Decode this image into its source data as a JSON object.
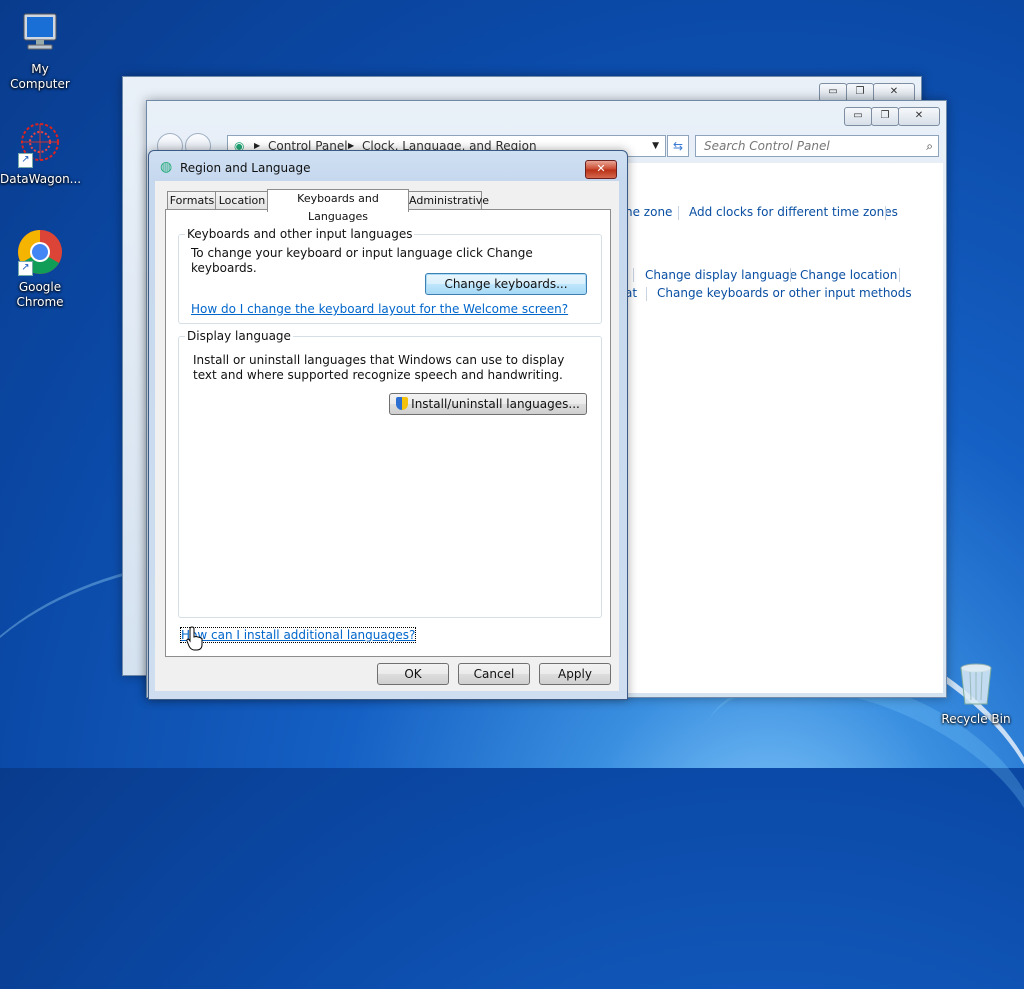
{
  "desktop": {
    "icons": [
      {
        "label": "My Computer"
      },
      {
        "label": "DataWagon..."
      },
      {
        "label": "Google Chrome"
      },
      {
        "label": "Recycle Bin"
      }
    ]
  },
  "control_panel": {
    "breadcrumb": [
      "Control Panel",
      "Clock, Language, and Region"
    ],
    "search_placeholder": "Search Control Panel",
    "links": {
      "time_zone_partial": "ne zone",
      "add_clocks": "Add clocks for different time zones",
      "change_display_language": "Change display language",
      "change_location": "Change location",
      "format_partial": "at",
      "change_keyboards": "Change keyboards or other input methods"
    }
  },
  "dialog": {
    "title": "Region and Language",
    "tabs": [
      "Formats",
      "Location",
      "Keyboards and Languages",
      "Administrative"
    ],
    "active_tab": "Keyboards and Languages",
    "keyboards_group": {
      "label": "Keyboards and other input languages",
      "text": "To change your keyboard or input language click Change keyboards.",
      "button": "Change keyboards...",
      "link": "How do I change the keyboard layout for the Welcome screen?"
    },
    "display_group": {
      "label": "Display language",
      "text": "Install or uninstall languages that Windows can use to display text and where supported recognize speech and handwriting.",
      "button": "Install/uninstall languages..."
    },
    "bottom_link": "How can I install additional languages?",
    "buttons": {
      "ok": "OK",
      "cancel": "Cancel",
      "apply": "Apply"
    }
  },
  "window_controls": {
    "minimize": "▭",
    "restore": "❐",
    "close": "✕"
  }
}
